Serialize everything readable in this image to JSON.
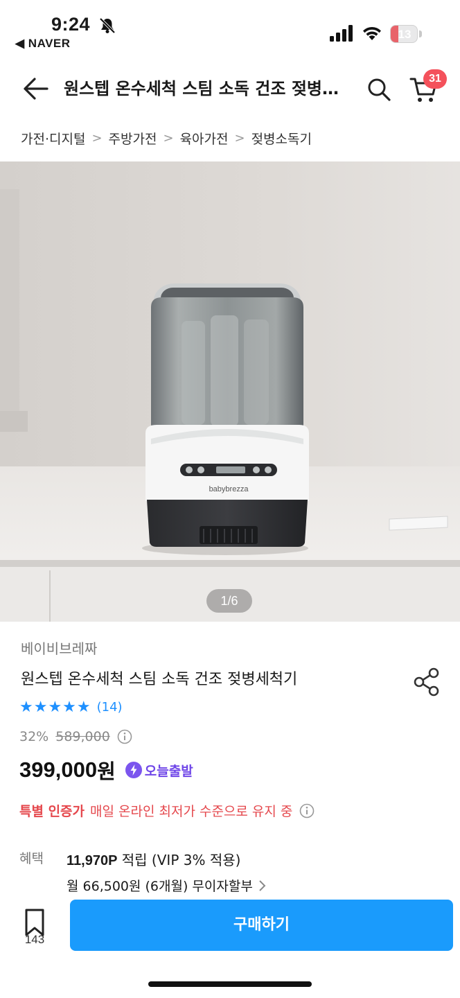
{
  "status_bar": {
    "time": "9:24",
    "back_app": "◀ NAVER",
    "battery_level": "13",
    "battery_color": "#e8636a"
  },
  "nav": {
    "title": "원스텝 온수세척 스팀 소독 건조 젖병세척기",
    "cart_count": "31"
  },
  "breadcrumb": [
    "가전·디지털",
    "주방가전",
    "육아가전",
    "젖병소독기"
  ],
  "gallery": {
    "indicator": "1/6",
    "product_logo": "babybrezza"
  },
  "product": {
    "brand": "베이비브레짜",
    "title": "원스텝 온수세척 스팀 소독 건조 젖병세척기",
    "stars": "★★★★★",
    "review_count": "(14)",
    "discount": "32%",
    "original_price": "589,000",
    "price": "399,000",
    "price_unit": "원",
    "delivery_badge": "오늘출발",
    "special_label": "특별 인증가",
    "special_desc": "매일 온라인 최저가 수준으로 유지 중"
  },
  "benefits": {
    "label": "혜택",
    "points": "11,970P",
    "points_suffix": " 적립 (VIP 3% 적용)",
    "installment": "월 66,500원 (6개월) 무이자할부"
  },
  "bottom_bar": {
    "bookmark_count": "143",
    "buy_label": "구매하기"
  },
  "colors": {
    "accent_blue": "#1a9bfc",
    "star_blue": "#1e90ff",
    "badge_red": "#f4515b",
    "special_red": "#e5484d",
    "today_purple": "#6f46e8"
  }
}
